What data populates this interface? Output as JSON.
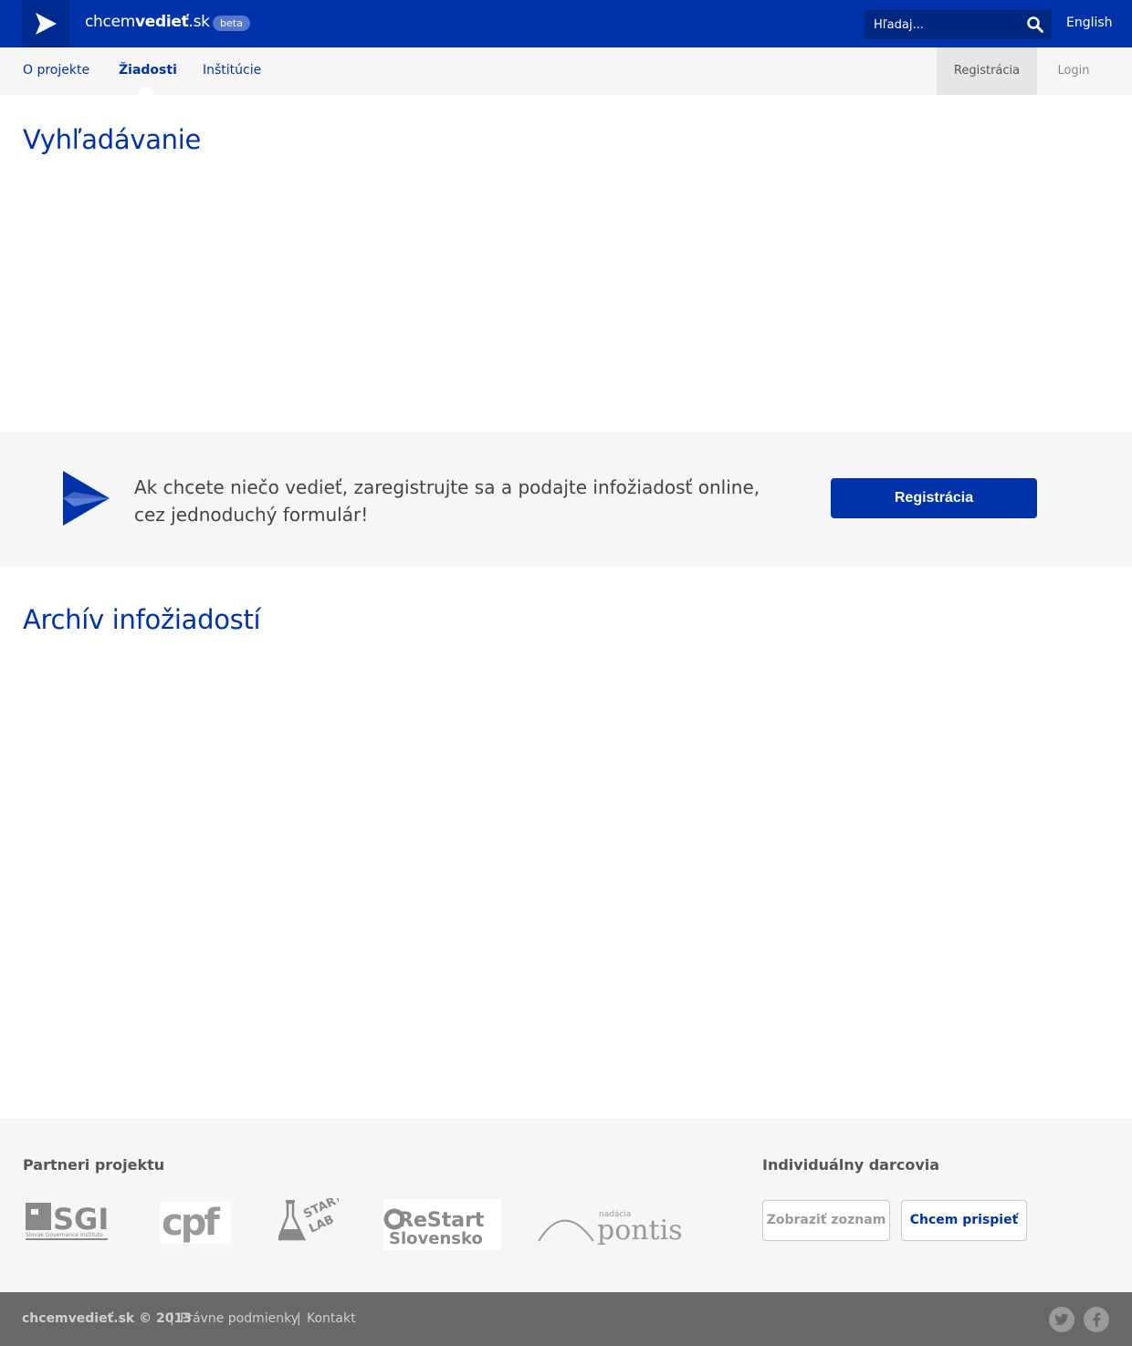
{
  "header": {
    "brand_prefix": "chcem",
    "brand_bold": "vedieť",
    "brand_suffix": ".sk",
    "badge": "beta",
    "search_placeholder": "Hľadaj...",
    "language": "English"
  },
  "nav": {
    "items": [
      {
        "label": "O projekte",
        "active": false
      },
      {
        "label": "Žiadosti",
        "active": true
      },
      {
        "label": "Inštitúcie",
        "active": false
      }
    ],
    "register": "Registrácia",
    "login": "Login"
  },
  "sections": {
    "search_title": "Vyhľadávanie",
    "archive_title": "Archív infožiadostí"
  },
  "cta": {
    "text": "Ak chcete niečo vedieť, zaregistrujte sa a podajte infožiadosť online, cez  jednoduchý formulár!",
    "button": "Registrácia"
  },
  "footer": {
    "partners_title": "Partneri projektu",
    "partners": [
      {
        "name": "SGI",
        "subtitle": "Slovak Governance Institute"
      },
      {
        "name": "cpf"
      },
      {
        "name": "START LAB"
      },
      {
        "name": "ReStart Slovensko"
      },
      {
        "name": "nadácia pontis"
      }
    ],
    "donors_title": "Individuálny darcovia",
    "show_list": "Zobraziť zoznam",
    "contribute": "Chcem prispieť"
  },
  "bottom": {
    "copyright": "chcemvedieť.sk © 2013",
    "sep": "|",
    "terms": "Právne podmienky",
    "contact": "Kontakt",
    "social": [
      "twitter-icon",
      "facebook-icon"
    ]
  },
  "colors": {
    "brand_blue": "#0033aa",
    "light_bg": "#f6f6f6",
    "bottom_bar": "#686868"
  }
}
